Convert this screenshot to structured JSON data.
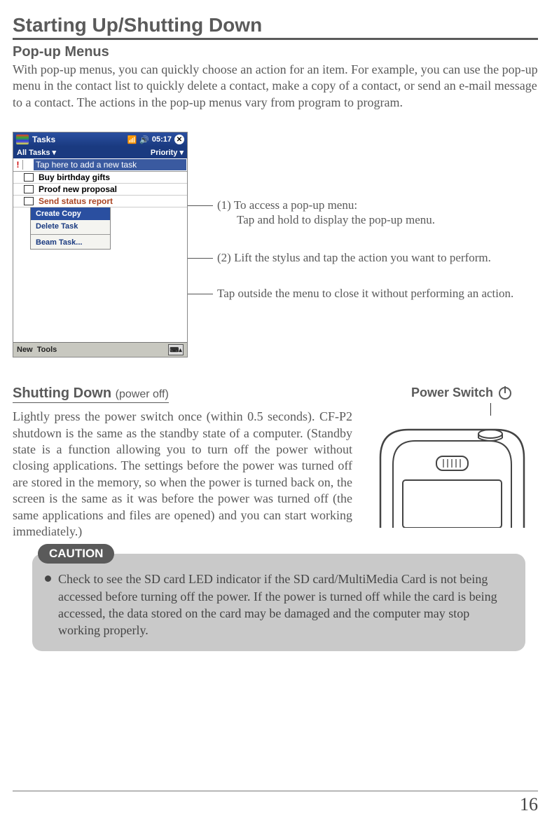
{
  "page_title": "Starting Up/Shutting Down",
  "popup": {
    "heading": "Pop-up Menus",
    "intro": "With pop-up menus, you can quickly choose an action for an item. For example, you can use the pop-up menu in the contact list to quickly delete a contact, make a copy of a contact, or send an e-mail message to a contact. The actions in the pop-up menus vary from program to program."
  },
  "pda": {
    "title": "Tasks",
    "time": "05:17",
    "subbar_left": "All Tasks",
    "subbar_right": "Priority",
    "add_task_placeholder": "Tap here to add a new task",
    "tasks": [
      "Buy birthday gifts",
      "Proof new proposal",
      "Send status report"
    ],
    "menu_items": [
      "Create Copy",
      "Delete Task",
      "Beam Task..."
    ],
    "footer_left": "New",
    "footer_left2": "Tools"
  },
  "callouts": {
    "c1_line1": "(1) To access a pop-up menu:",
    "c1_line2": "Tap and hold to display the pop-up menu.",
    "c2": "(2) Lift the stylus and tap the action you want to perform.",
    "c3": "Tap outside the menu to close it without performing an action."
  },
  "shutdown": {
    "heading": "Shutting Down",
    "heading_sub": "(power off)",
    "body": "Lightly press the power switch once (within 0.5 seconds). CF-P2 shutdown is the same as the standby state of a computer. (Standby state is a function allowing you to turn off the power without closing applications. The settings before the power was turned off are stored in the memory, so when the power is turned back on, the screen is the same as it was before the power was turned off (the same applications and files are opened) and you can start working immediately.)",
    "power_switch_label": "Power Switch"
  },
  "caution": {
    "label": "CAUTION",
    "text": "Check to see the SD card LED indicator if the SD card/MultiMedia Card is not being accessed before turning off the power. If the power is turned off while the card is being accessed, the data stored on the card may be damaged and the computer may stop working properly."
  },
  "page_number": "16"
}
